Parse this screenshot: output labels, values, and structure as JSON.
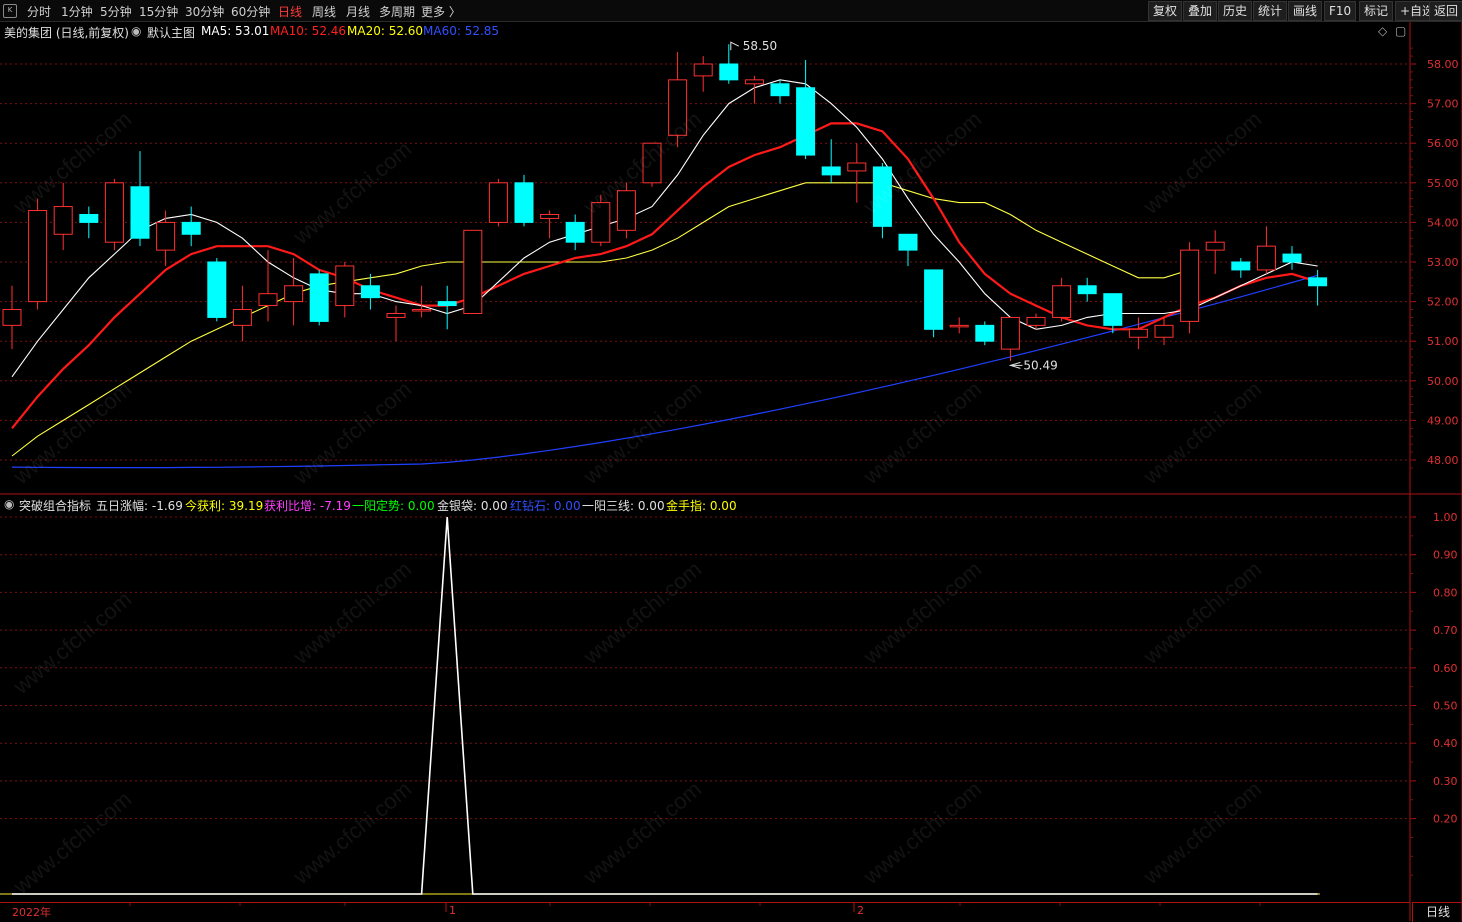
{
  "toolbar": {
    "periods": [
      "分时",
      "1分钟",
      "5分钟",
      "15分钟",
      "30分钟",
      "60分钟",
      "日线",
      "周线",
      "月线",
      "多周期",
      "更多 〉"
    ],
    "active_period": "日线",
    "right_buttons": [
      "复权",
      "叠加",
      "历史",
      "统计",
      "画线",
      "F10",
      "标记",
      "+自选",
      "返回"
    ]
  },
  "main_chart": {
    "stock_label": "美的集团 (日线,前复权)",
    "template_label": "默认主图",
    "ma": [
      {
        "label": "MA5: 53.01",
        "color": "#ffffff"
      },
      {
        "label": "MA10: 52.46",
        "color": "#ff2020"
      },
      {
        "label": "MA20: 52.60",
        "color": "#ffff00"
      },
      {
        "label": "MA60: 52.85",
        "color": "#3050ff"
      }
    ],
    "high_label": "58.50",
    "low_label": "50.49",
    "price_axis": [
      "58.00",
      "57.00",
      "56.00",
      "55.00",
      "54.00",
      "53.00",
      "52.00",
      "51.00",
      "50.00",
      "49.00",
      "48.00"
    ],
    "colors": {
      "up": "#ff3030",
      "down": "#00ffff",
      "ma5": "#ffffff",
      "ma10": "#ff1a1a",
      "ma20": "#ffff40",
      "ma60": "#2040ff"
    }
  },
  "chart_data": [
    {
      "type": "candlestick",
      "title": "美的集团 (日线,前复权)",
      "ylim": [
        47.7,
        58.6
      ],
      "candles": [
        {
          "o": 51.4,
          "c": 51.8,
          "h": 52.4,
          "l": 50.8
        },
        {
          "o": 52.0,
          "c": 54.3,
          "h": 54.6,
          "l": 51.8
        },
        {
          "o": 53.7,
          "c": 54.4,
          "h": 55.0,
          "l": 53.3
        },
        {
          "o": 54.2,
          "c": 54.0,
          "h": 54.4,
          "l": 53.6
        },
        {
          "o": 53.5,
          "c": 55.0,
          "h": 55.1,
          "l": 53.3
        },
        {
          "o": 54.9,
          "c": 53.6,
          "h": 55.8,
          "l": 53.4
        },
        {
          "o": 53.3,
          "c": 54.0,
          "h": 54.3,
          "l": 52.9
        },
        {
          "o": 54.0,
          "c": 53.7,
          "h": 54.4,
          "l": 53.4
        },
        {
          "o": 53.0,
          "c": 51.6,
          "h": 53.1,
          "l": 51.5
        },
        {
          "o": 51.4,
          "c": 51.8,
          "h": 52.4,
          "l": 51.0
        },
        {
          "o": 51.9,
          "c": 52.2,
          "h": 53.3,
          "l": 51.5
        },
        {
          "o": 52.0,
          "c": 52.4,
          "h": 53.1,
          "l": 51.4
        },
        {
          "o": 52.7,
          "c": 51.5,
          "h": 52.8,
          "l": 51.4
        },
        {
          "o": 51.9,
          "c": 52.9,
          "h": 53.0,
          "l": 51.6
        },
        {
          "o": 52.4,
          "c": 52.1,
          "h": 52.7,
          "l": 51.8
        },
        {
          "o": 51.6,
          "c": 51.7,
          "h": 51.9,
          "l": 51.0
        },
        {
          "o": 51.8,
          "c": 51.8,
          "h": 52.4,
          "l": 51.6
        },
        {
          "o": 52.0,
          "c": 51.9,
          "h": 52.4,
          "l": 51.3
        },
        {
          "o": 51.7,
          "c": 53.8,
          "h": 53.8,
          "l": 51.7
        },
        {
          "o": 54.0,
          "c": 55.0,
          "h": 55.1,
          "l": 53.9
        },
        {
          "o": 55.0,
          "c": 54.0,
          "h": 55.2,
          "l": 53.9
        },
        {
          "o": 54.1,
          "c": 54.2,
          "h": 54.3,
          "l": 53.6
        },
        {
          "o": 54.0,
          "c": 53.5,
          "h": 54.2,
          "l": 53.3
        },
        {
          "o": 53.5,
          "c": 54.5,
          "h": 54.7,
          "l": 53.4
        },
        {
          "o": 53.8,
          "c": 54.8,
          "h": 55.0,
          "l": 53.6
        },
        {
          "o": 55.0,
          "c": 56.0,
          "h": 56.0,
          "l": 54.9
        },
        {
          "o": 56.2,
          "c": 57.6,
          "h": 58.3,
          "l": 55.9
        },
        {
          "o": 57.7,
          "c": 58.0,
          "h": 58.2,
          "l": 57.3
        },
        {
          "o": 58.0,
          "c": 57.6,
          "h": 58.5,
          "l": 57.5
        },
        {
          "o": 57.5,
          "c": 57.6,
          "h": 57.7,
          "l": 57.0
        },
        {
          "o": 57.5,
          "c": 57.2,
          "h": 57.6,
          "l": 57.0
        },
        {
          "o": 57.4,
          "c": 55.7,
          "h": 58.1,
          "l": 55.6
        },
        {
          "o": 55.4,
          "c": 55.2,
          "h": 56.1,
          "l": 55.0
        },
        {
          "o": 55.3,
          "c": 55.5,
          "h": 56.0,
          "l": 54.5
        },
        {
          "o": 55.4,
          "c": 53.9,
          "h": 55.5,
          "l": 53.6
        },
        {
          "o": 53.7,
          "c": 53.3,
          "h": 53.7,
          "l": 52.9
        },
        {
          "o": 52.8,
          "c": 51.3,
          "h": 52.8,
          "l": 51.1
        },
        {
          "o": 51.4,
          "c": 51.4,
          "h": 51.6,
          "l": 51.2
        },
        {
          "o": 51.4,
          "c": 51.0,
          "h": 51.5,
          "l": 50.9
        },
        {
          "o": 50.8,
          "c": 51.6,
          "h": 51.6,
          "l": 50.5
        },
        {
          "o": 51.4,
          "c": 51.6,
          "h": 51.7,
          "l": 51.3
        },
        {
          "o": 51.6,
          "c": 52.4,
          "h": 52.6,
          "l": 51.5
        },
        {
          "o": 52.4,
          "c": 52.2,
          "h": 52.6,
          "l": 52.0
        },
        {
          "o": 52.2,
          "c": 51.4,
          "h": 52.2,
          "l": 51.2
        },
        {
          "o": 51.1,
          "c": 51.3,
          "h": 51.6,
          "l": 50.8
        },
        {
          "o": 51.1,
          "c": 51.4,
          "h": 51.6,
          "l": 50.9
        },
        {
          "o": 51.5,
          "c": 53.3,
          "h": 53.5,
          "l": 51.2
        },
        {
          "o": 53.3,
          "c": 53.5,
          "h": 53.8,
          "l": 52.7
        },
        {
          "o": 53.0,
          "c": 52.8,
          "h": 53.1,
          "l": 52.6
        },
        {
          "o": 52.8,
          "c": 53.4,
          "h": 53.9,
          "l": 52.7
        },
        {
          "o": 53.2,
          "c": 53.0,
          "h": 53.4,
          "l": 52.8
        },
        {
          "o": 52.6,
          "c": 52.4,
          "h": 52.8,
          "l": 51.9
        }
      ],
      "ma5": [
        50.1,
        51.0,
        51.8,
        52.6,
        53.2,
        53.8,
        54.1,
        54.2,
        54.0,
        53.6,
        53.0,
        52.6,
        52.3,
        52.2,
        52.2,
        52.0,
        51.9,
        51.7,
        51.9,
        52.5,
        53.1,
        53.5,
        53.7,
        53.9,
        54.1,
        54.4,
        55.2,
        56.2,
        57.0,
        57.4,
        57.6,
        57.5,
        57.0,
        56.4,
        55.6,
        54.6,
        53.7,
        53.0,
        52.2,
        51.6,
        51.3,
        51.4,
        51.6,
        51.7,
        51.7,
        51.7,
        51.8,
        52.1,
        52.4,
        52.7,
        53.0,
        52.9
      ],
      "ma10": [
        48.8,
        49.6,
        50.3,
        50.9,
        51.6,
        52.2,
        52.8,
        53.2,
        53.4,
        53.4,
        53.4,
        53.2,
        52.8,
        52.6,
        52.3,
        52.1,
        51.9,
        51.9,
        52.1,
        52.4,
        52.7,
        52.9,
        53.1,
        53.2,
        53.4,
        53.7,
        54.3,
        54.9,
        55.4,
        55.7,
        55.9,
        56.2,
        56.5,
        56.5,
        56.3,
        55.6,
        54.6,
        53.5,
        52.7,
        52.2,
        51.9,
        51.6,
        51.4,
        51.3,
        51.3,
        51.6,
        51.9,
        52.1,
        52.4,
        52.6,
        52.7,
        52.5
      ],
      "ma20": [
        48.1,
        48.6,
        49.0,
        49.4,
        49.8,
        50.2,
        50.6,
        51.0,
        51.3,
        51.6,
        51.9,
        52.2,
        52.4,
        52.5,
        52.6,
        52.7,
        52.9,
        53.0,
        53.0,
        53.0,
        53.0,
        53.0,
        53.0,
        53.0,
        53.1,
        53.3,
        53.6,
        54.0,
        54.4,
        54.6,
        54.8,
        55.0,
        55.0,
        55.0,
        55.0,
        54.8,
        54.6,
        54.5,
        54.5,
        54.2,
        53.8,
        53.5,
        53.2,
        52.9,
        52.6,
        52.6,
        52.8
      ]
    },
    {
      "type": "line",
      "title": "突破组合指标",
      "ylim": [
        0,
        1.05
      ],
      "values": [
        0,
        0,
        0,
        0,
        0,
        0,
        0,
        0,
        0,
        0,
        0,
        0,
        0,
        0,
        0,
        0,
        0,
        1,
        0,
        0,
        0,
        0,
        0,
        0,
        0,
        0,
        0,
        0,
        0,
        0,
        0,
        0,
        0,
        0,
        0,
        0,
        0,
        0,
        0,
        0,
        0,
        0,
        0,
        0,
        0,
        0,
        0,
        0,
        0,
        0,
        0,
        0
      ]
    }
  ],
  "sub_chart": {
    "indicator_name": "突破组合指标",
    "items": [
      {
        "label": "五日涨幅:",
        "value": "-1.69",
        "color": "#e0e0e0"
      },
      {
        "label": "今获利:",
        "value": "39.19",
        "color": "#ffff00"
      },
      {
        "label": "获利比增:",
        "value": "-7.19",
        "color": "#ff40ff"
      },
      {
        "label": "一阳定势:",
        "value": "0.00",
        "color": "#00ff00"
      },
      {
        "label": "金银袋:",
        "value": "0.00",
        "color": "#e0e0e0"
      },
      {
        "label": "红钻石:",
        "value": "0.00",
        "color": "#3050ff"
      },
      {
        "label": "一阳三线:",
        "value": "0.00",
        "color": "#e0e0e0"
      },
      {
        "label": "金手指:",
        "value": "0.00",
        "color": "#ffff00"
      }
    ],
    "axis": [
      "1.00",
      "0.90",
      "0.80",
      "0.70",
      "0.60",
      "0.50",
      "0.40",
      "0.30",
      "0.20"
    ]
  },
  "date_axis": {
    "labels": [
      "2022年",
      "1",
      "2"
    ]
  },
  "period_label": "日线",
  "watermark": "www.cfchi.com"
}
